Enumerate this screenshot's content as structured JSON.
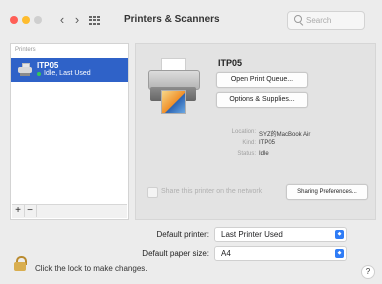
{
  "window": {
    "title": "Printers & Scanners",
    "search": {
      "placeholder": "Search"
    }
  },
  "nav": {
    "back_symbol": "‹",
    "forward_symbol": "›"
  },
  "sidebar": {
    "section_label": "Printers",
    "printers": [
      {
        "name": "ITP05",
        "status": "Idle, Last Used",
        "selected": true
      }
    ],
    "add_symbol": "+",
    "remove_symbol": "−"
  },
  "detail": {
    "printer_name": "ITP05",
    "open_queue_label": "Open Print Queue...",
    "options_label": "Options & Supplies...",
    "info": [
      {
        "label": "Location:",
        "value": "SYZ的MacBook Air"
      },
      {
        "label": "Kind:",
        "value": "ITP05"
      },
      {
        "label": "Status:",
        "value": "Idle"
      }
    ],
    "share_label": "Share this printer on the network",
    "sharing_button_label": "Sharing Preferences..."
  },
  "defaults": {
    "printer_label": "Default printer:",
    "printer_value": "Last Printer Used",
    "paper_label": "Default paper size:",
    "paper_value": "A4",
    "popup_arrow_symbol": "◆"
  },
  "footer": {
    "lock_label": "Click the lock to make changes.",
    "help_symbol": "?"
  },
  "colors": {
    "selection": "#2f62c8",
    "accent": "#2f7cf6",
    "status_green": "#34c759",
    "close": "#ff5f57",
    "minimize": "#febc2e"
  },
  "icons": {
    "back": "chevron-left-icon",
    "forward": "chevron-right-icon",
    "grid": "grid-icon",
    "search": "search-icon",
    "printer": "printer-icon",
    "lock": "lock-icon",
    "help": "help-icon"
  }
}
